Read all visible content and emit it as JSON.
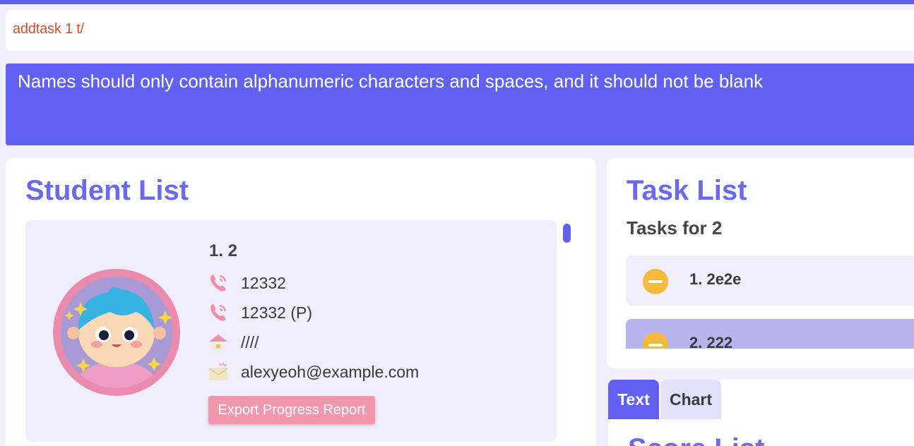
{
  "command_box": {
    "value": "addtask 1 t/"
  },
  "result_display": {
    "message": "Names should only contain alphanumeric characters and spaces, and it should not be blank"
  },
  "student_panel": {
    "title": "Student List",
    "students": [
      {
        "name": "1.  2",
        "phone": "12332",
        "parent_phone": "12332 (P)",
        "address": "////",
        "email": "alexyeoh@example.com",
        "export_label": "Export Progress Report"
      }
    ]
  },
  "task_panel": {
    "title": "Task List",
    "subtitle": "Tasks for 2",
    "tasks": [
      {
        "label": "1. 2e2e",
        "status_icon": "minus-circle-icon"
      },
      {
        "label": "2. 222",
        "status_icon": "minus-circle-icon"
      }
    ]
  },
  "tabs": {
    "items": [
      "Text",
      "Chart"
    ],
    "selected": "Text"
  },
  "lower_panel": {
    "heading_cut": "Score List"
  },
  "colors": {
    "accent": "#6161f1",
    "title": "#6a6aea",
    "command_text": "#d2512a",
    "export_button": "#f497ae",
    "task_status": "#f6b93c"
  }
}
